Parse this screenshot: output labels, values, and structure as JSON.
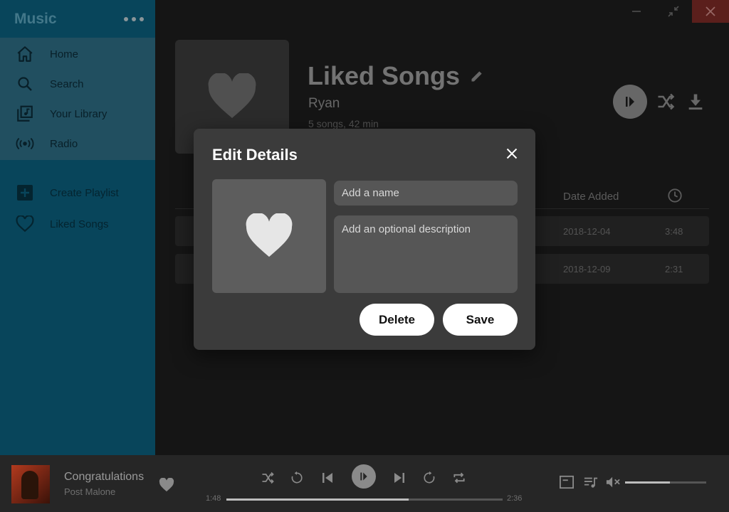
{
  "sidebar": {
    "title": "Music",
    "nav": [
      {
        "label": "Home",
        "icon": "home-icon"
      },
      {
        "label": "Search",
        "icon": "search-icon"
      },
      {
        "label": "Your Library",
        "icon": "library-icon"
      },
      {
        "label": "Radio",
        "icon": "radio-icon"
      }
    ],
    "playlists": [
      {
        "label": "Create Playlist",
        "icon": "add-box-icon"
      },
      {
        "label": "Liked Songs",
        "icon": "heart-outline-icon"
      }
    ]
  },
  "playlist": {
    "title": "Liked Songs",
    "owner": "Ryan",
    "meta": "5 songs, 42 min"
  },
  "table": {
    "date_header": "Date Added",
    "rows": [
      {
        "date": "2018-12-04",
        "duration": "3:48"
      },
      {
        "date": "2018-12-09",
        "duration": "2:31"
      }
    ]
  },
  "dialog": {
    "title": "Edit Details",
    "name_placeholder": "Add a name",
    "desc_placeholder": "Add an optional description",
    "delete_label": "Delete",
    "save_label": "Save"
  },
  "player": {
    "track": "Congratulations",
    "artist": "Post Malone",
    "elapsed": "1:48",
    "total": "2:36",
    "progress": 0.66,
    "volume": 0.55
  },
  "colors": {
    "sidebar": "#0b5c7a",
    "sidebar_top": "#2d6a81",
    "close_button": "#7a2a26",
    "dialog": "#3b3b3b"
  }
}
